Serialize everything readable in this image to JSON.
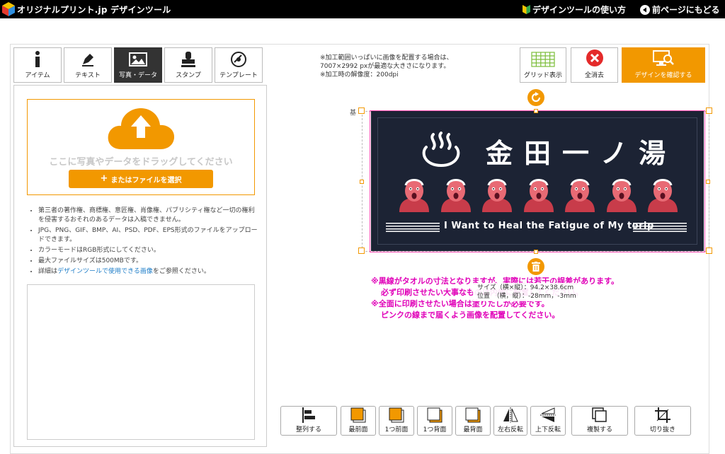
{
  "header": {
    "brand": "オリジナルプリント.jp デザインツール",
    "help_link": "デザインツールの使い方",
    "back_link": "前ページにもどる"
  },
  "tabs": [
    {
      "label": "アイテム",
      "icon": "info-icon"
    },
    {
      "label": "テキスト",
      "icon": "pen-icon"
    },
    {
      "label": "写真・データ",
      "icon": "image-icon",
      "active": true
    },
    {
      "label": "スタンプ",
      "icon": "stamp-icon"
    },
    {
      "label": "テンプレート",
      "icon": "template-icon"
    }
  ],
  "upload": {
    "drop_text": "ここに写真やデータをドラッグしてください",
    "select_button": "またはファイルを選択"
  },
  "notes": [
    "第三者の著作権、商標権、意匠権、肖像権、パブリシティ権など一切の権利を侵害するおそれのあるデータは入稿できません。",
    "JPG、PNG、GIF、BMP、AI、PSD、PDF、EPS形式のファイルをアップロードできます。",
    "カラーモードはRGB形式にしてください。",
    "最大ファイルサイズは500MBです。"
  ],
  "notes_last": {
    "prefix": "詳細は",
    "link": "デザインツールで使用できる画像",
    "suffix": "をご参照ください。"
  },
  "info": {
    "line1": "※加工範囲いっぱいに画像を配置する場合は、",
    "line2": "7007×2992 pxが最適な大きさになります。",
    "line3": "※加工時の解像度：200dpi"
  },
  "toolbar": {
    "grid": "グリッド表示",
    "clear": "全消去",
    "confirm": "デザインを確認する"
  },
  "canvas": {
    "kiji_label": "基",
    "title": "金田一ノ湯",
    "slogan": "I Want to Heal the Fatigue of My torip",
    "tooltip_size": "サイズ（横×縦）：94.2×38.6cm",
    "tooltip_pos": "位置　（横，縦）：-28mm，-3mm"
  },
  "warnings": {
    "line1": "※黒線がタオルの寸法となりますが、実際には若干の誤差があります。",
    "line2": "必ず印刷させたい大事なものは内側に配置してください。",
    "line3": "※全面に印刷させたい場合は塗りたしが必要です。",
    "line4": "ピンクの線まで届くよう画像を配置してください。"
  },
  "bottom_tools": [
    {
      "label": "整列する",
      "icon": "align-icon"
    },
    {
      "label": "最前面",
      "icon": "bring-front-icon"
    },
    {
      "label": "1つ前面",
      "icon": "bring-forward-icon"
    },
    {
      "label": "1つ背面",
      "icon": "send-backward-icon"
    },
    {
      "label": "最背面",
      "icon": "send-back-icon"
    },
    {
      "label": "左右反転",
      "icon": "flip-horizontal-icon"
    },
    {
      "label": "上下反転",
      "icon": "flip-vertical-icon"
    },
    {
      "label": "複製する",
      "icon": "duplicate-icon"
    },
    {
      "label": "切り抜き",
      "icon": "crop-icon"
    }
  ],
  "colors": {
    "accent": "#f29800",
    "towel": "#1c2334",
    "pink_guide": "#ff4fb5",
    "warning_text": "#e000b8"
  }
}
